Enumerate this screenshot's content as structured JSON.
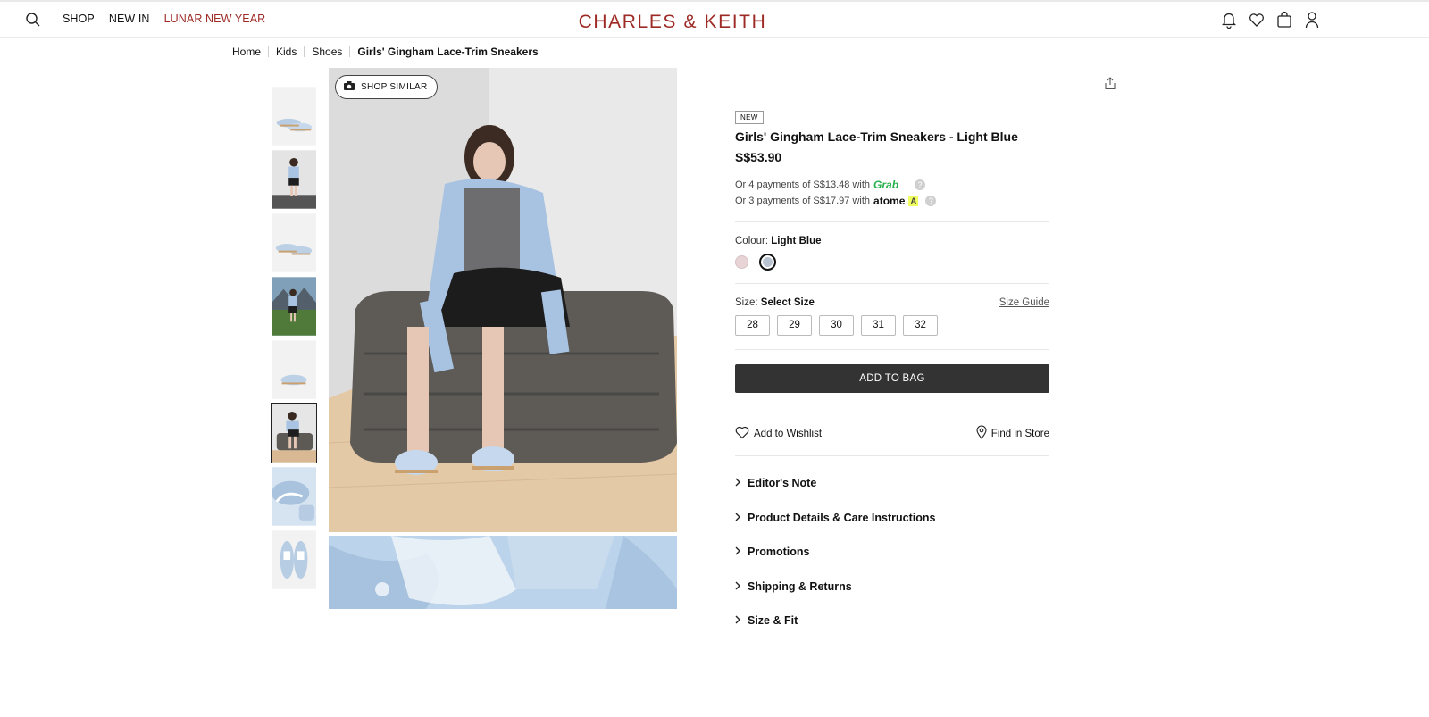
{
  "header": {
    "logo": "CHARLES & KEITH",
    "nav": [
      "SHOP",
      "NEW IN",
      "LUNAR NEW YEAR"
    ]
  },
  "breadcrumb": [
    "Home",
    "Kids",
    "Shoes",
    "Girls' Gingham Lace-Trim Sneakers"
  ],
  "gallery": {
    "shop_similar": "SHOP SIMILAR",
    "thumbnail_count": 8,
    "selected_thumbnail": 6
  },
  "product": {
    "badge": "NEW",
    "title": "Girls' Gingham Lace-Trim Sneakers - Light Blue",
    "price": "S$53.90",
    "installments": [
      {
        "text": "Or 4 payments of S$13.48 with",
        "provider": "Grab"
      },
      {
        "text": "Or 3 payments of S$17.97 with",
        "provider": "atome"
      }
    ],
    "colour_label": "Colour:",
    "colour_value": "Light Blue",
    "colours": [
      "#e8d4d6",
      "#b9c3cf"
    ],
    "size_label": "Size:",
    "size_value": "Select Size",
    "size_guide": "Size Guide",
    "sizes": [
      "28",
      "29",
      "30",
      "31",
      "32"
    ],
    "add_to_bag": "ADD TO BAG",
    "wishlist": "Add to Wishlist",
    "find_in_store": "Find in Store",
    "accordions": [
      "Editor's Note",
      "Product Details & Care Instructions",
      "Promotions",
      "Shipping & Returns",
      "Size & Fit"
    ]
  },
  "colors": {
    "brand": "#9d2a25",
    "button": "#333333",
    "grab": "#27b14c"
  }
}
